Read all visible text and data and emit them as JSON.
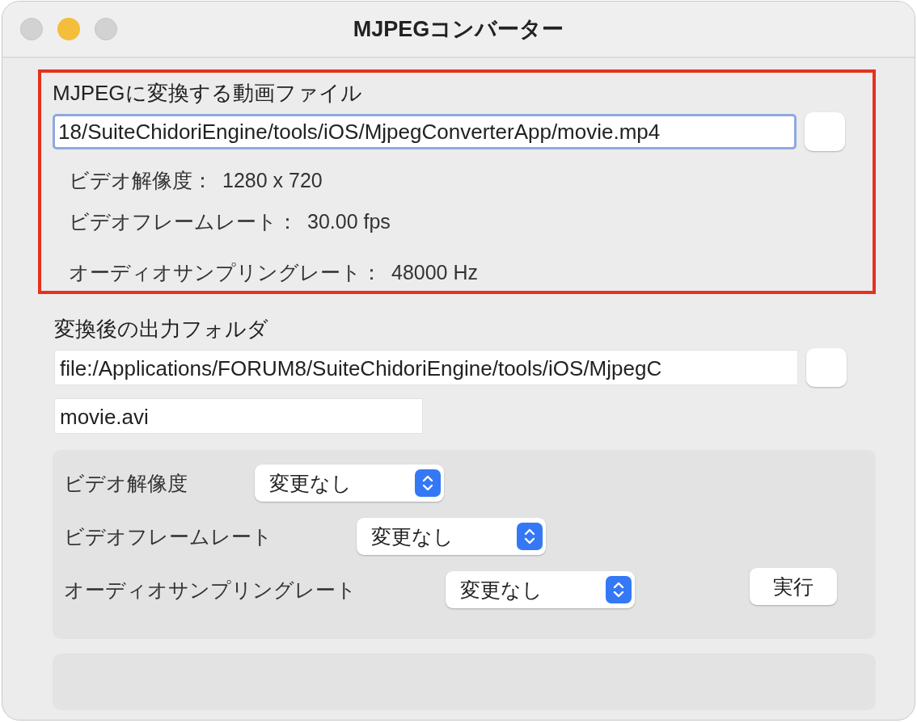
{
  "window": {
    "title": "MJPEGコンバーター"
  },
  "file_section": {
    "highlighted": true,
    "label": "MJPEGに変換する動画ファイル",
    "path_field": {
      "value": "18/SuiteChidoriEngine/tools/iOS/MjpegConverterApp/movie.mp4",
      "focused": true
    },
    "info": [
      {
        "label": "ビデオ解像度：",
        "value": "1280 x 720"
      },
      {
        "label": "ビデオフレームレート：",
        "value": "30.00 fps"
      },
      {
        "label": "オーディオサンプリングレート：",
        "value": "48000 Hz"
      }
    ]
  },
  "output_section": {
    "label": "変換後の出力フォルダ",
    "folder_field": {
      "value": "file:/Applications/FORUM8/SuiteChidoriEngine/tools/iOS/MjpegC",
      "focused": false
    },
    "filename_field": {
      "value": "movie.avi"
    }
  },
  "options": [
    {
      "label": "ビデオ解像度",
      "value": "変更なし"
    },
    {
      "label": "ビデオフレームレート",
      "value": "変更なし"
    },
    {
      "label": "オーディオサンプリングレート",
      "value": "変更なし"
    }
  ],
  "run_button": {
    "label": "実行"
  }
}
